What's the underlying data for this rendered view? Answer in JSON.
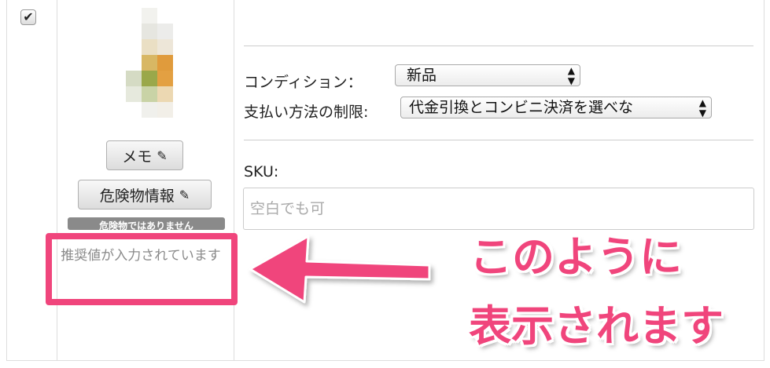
{
  "row": {
    "checkbox_checked": true,
    "checkbox_mark": "✔"
  },
  "product": {
    "memo_button": "メモ",
    "hazard_button": "危険物情報",
    "pencil_icon": "✎",
    "hazard_status": "危険物ではありません",
    "suggested_value_note": "推奨値が入力されています"
  },
  "condition": {
    "label": "コンディション：",
    "value": "新品"
  },
  "payment": {
    "label": "支払い方法の制限:",
    "value": "代金引換とコンビニ決済を選べな"
  },
  "sku": {
    "label": "SKU:",
    "placeholder": "空白でも可"
  },
  "annotation": {
    "line1": "このように",
    "line2": "表示されます",
    "color": "#f0457c"
  }
}
